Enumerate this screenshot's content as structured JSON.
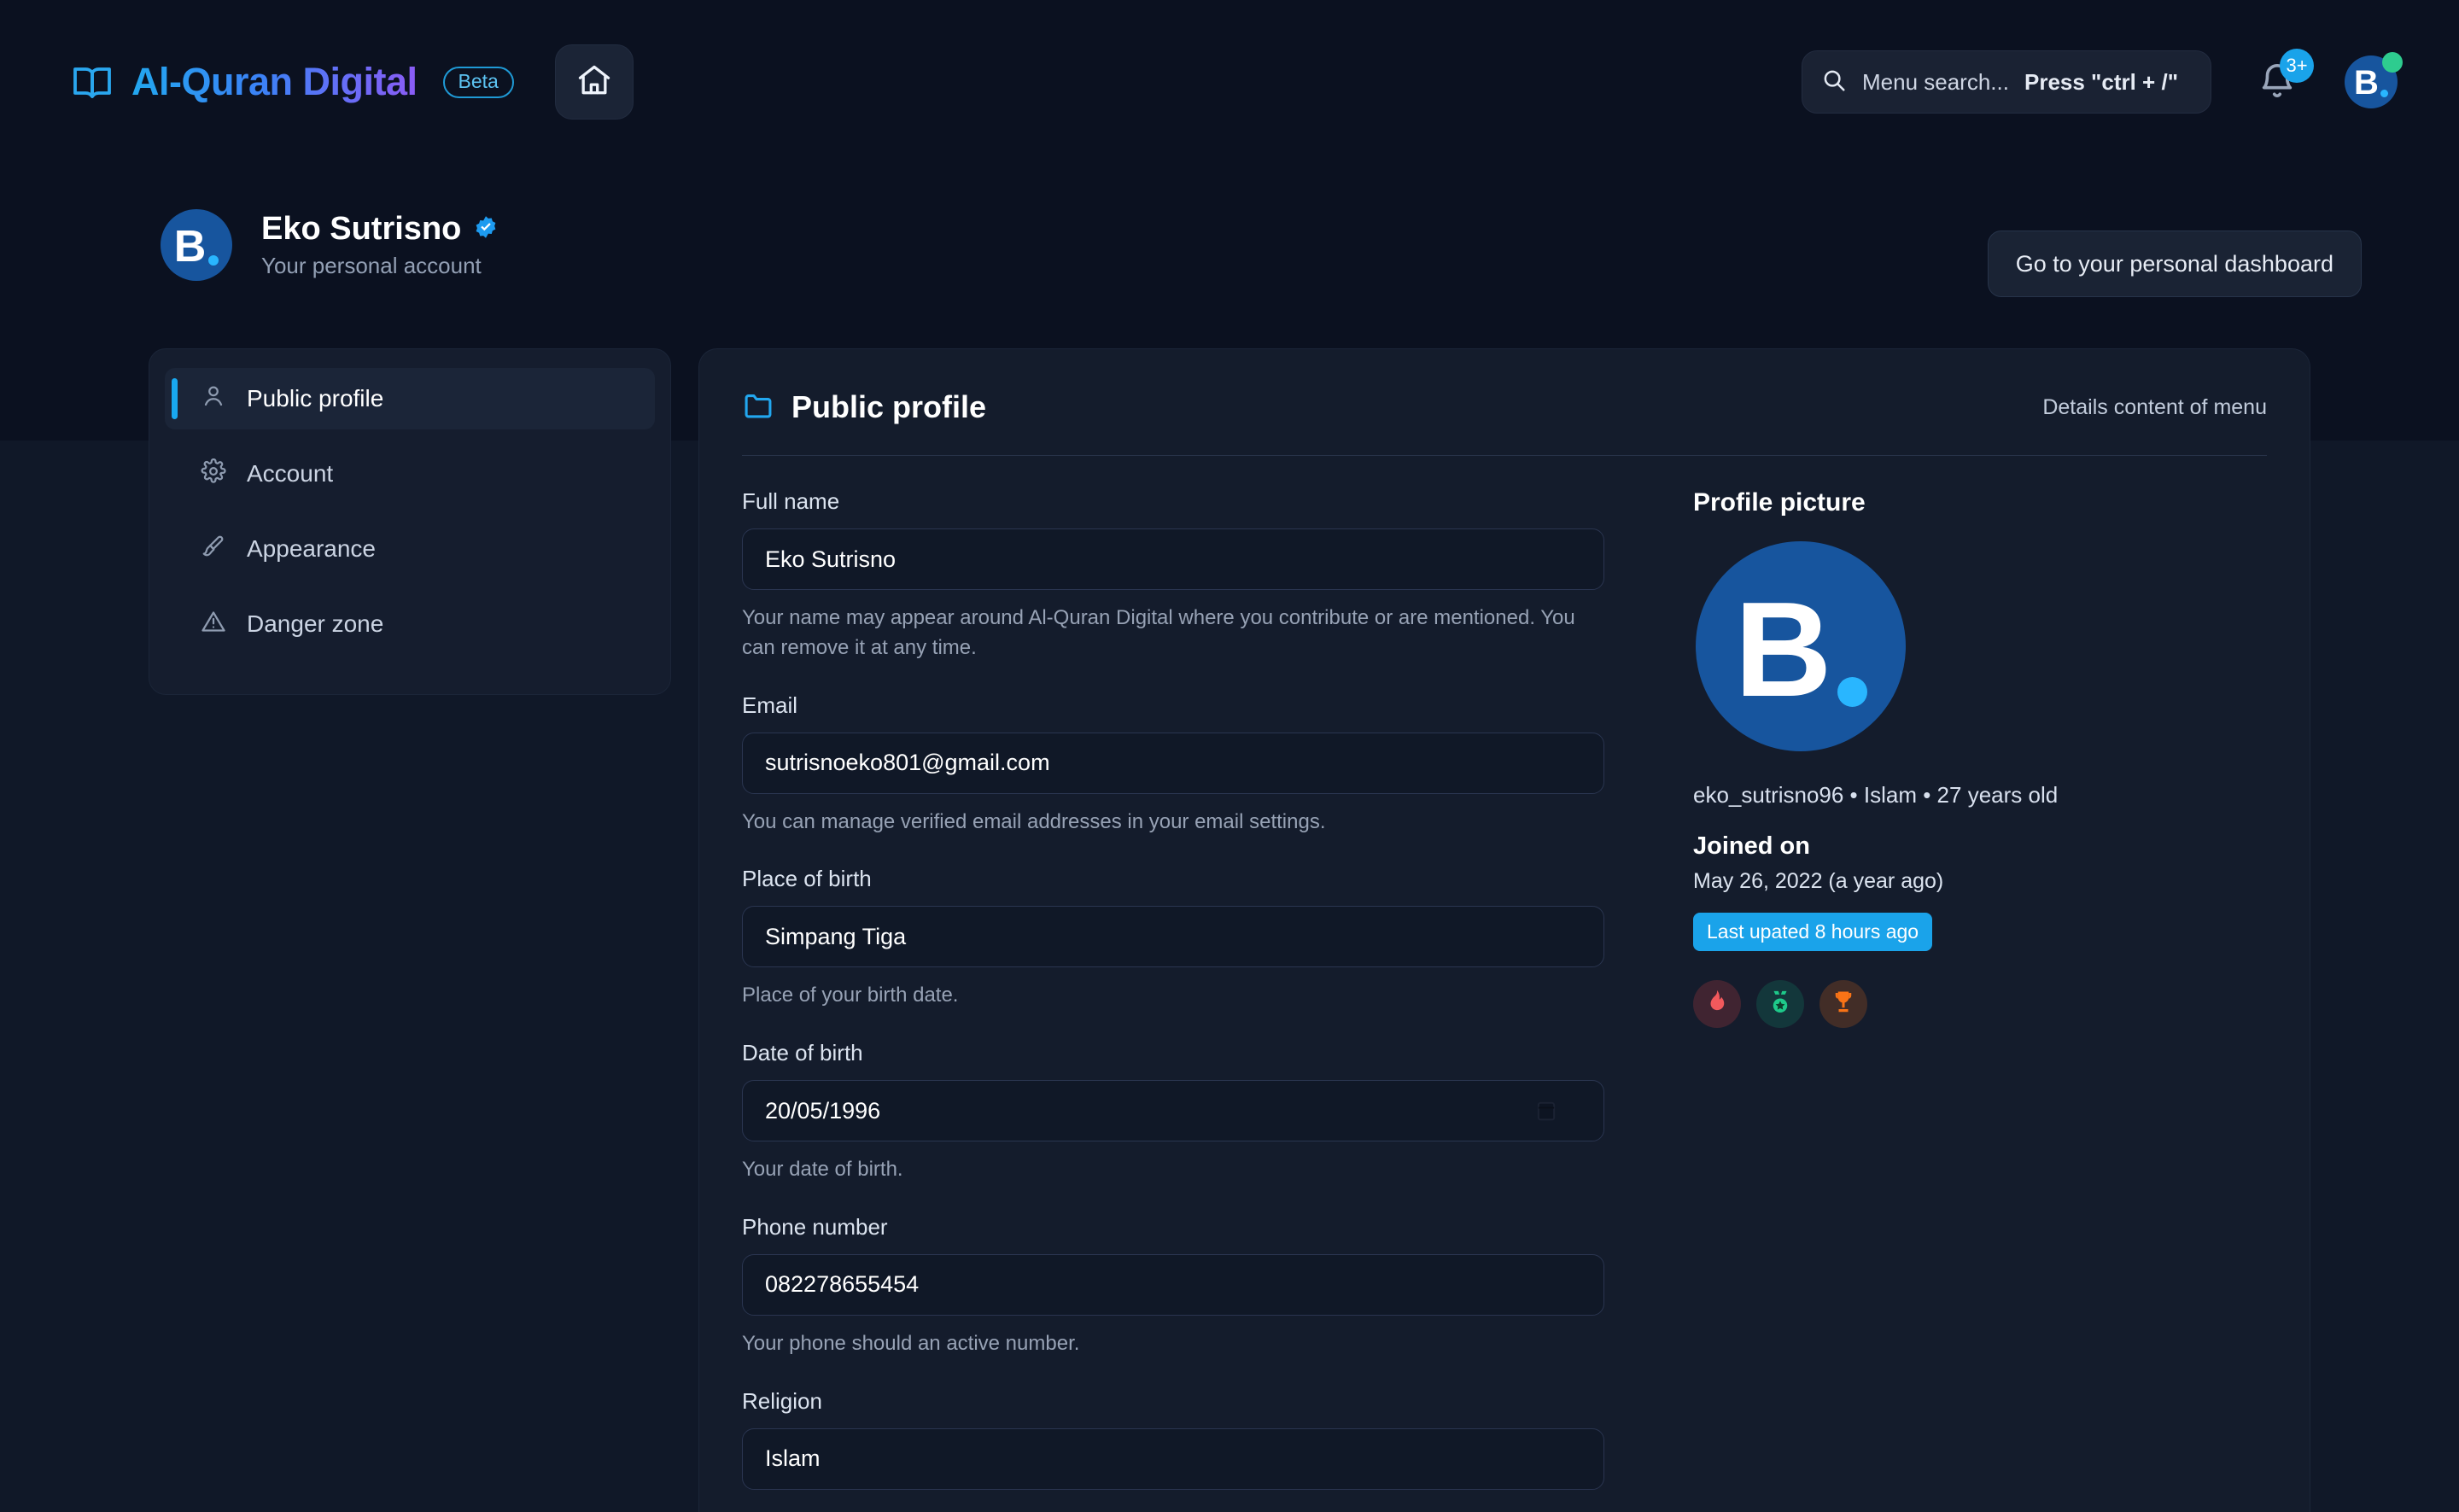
{
  "app": {
    "brand_name": "Al-Quran Digital",
    "beta_label": "Beta",
    "book_icon": "book-icon",
    "home_icon": "home-icon"
  },
  "topbar": {
    "search_placeholder": "Menu search...",
    "search_hint": "Press \"ctrl + /\"",
    "search_icon": "search-icon",
    "bell_icon": "bell-icon",
    "notification_count": "3+",
    "avatar_letter": "B",
    "status": "online"
  },
  "profile_header": {
    "avatar_letter": "B",
    "name": "Eko Sutrisno",
    "verified_icon": "verified-badge-icon",
    "subtitle": "Your personal account",
    "dashboard_button": "Go to your personal dashboard"
  },
  "sidebar": {
    "items": [
      {
        "label": "Public profile",
        "icon": "user-icon",
        "active": true
      },
      {
        "label": "Account",
        "icon": "gear-icon",
        "active": false
      },
      {
        "label": "Appearance",
        "icon": "brush-icon",
        "active": false
      },
      {
        "label": "Danger zone",
        "icon": "warning-triangle-icon",
        "active": false
      }
    ]
  },
  "main": {
    "title": "Public profile",
    "title_icon": "folder-icon",
    "details_label": "Details content of menu",
    "fields": [
      {
        "label": "Full name",
        "value": "Eko Sutrisno",
        "hint": "Your name may appear around Al-Quran Digital where you contribute or are mentioned. You can remove it at any time."
      },
      {
        "label": "Email",
        "value": "sutrisnoeko801@gmail.com",
        "hint": "You can manage verified email addresses in your email settings."
      },
      {
        "label": "Place of birth",
        "value": "Simpang Tiga",
        "hint": "Place of your birth date."
      },
      {
        "label": "Date of birth",
        "value": "20/05/1996",
        "hint": "Your date of birth.",
        "icon": "calendar-icon"
      },
      {
        "label": "Phone number",
        "value": "082278655454",
        "hint": "Your phone should an active number."
      },
      {
        "label": "Religion",
        "value": "Islam",
        "hint": ""
      }
    ]
  },
  "side_panel": {
    "picture_title": "Profile picture",
    "avatar_letter": "B",
    "meta": "eko_sutrisno96 • Islam • 27 years old",
    "joined_title": "Joined on",
    "joined_date": "May 26, 2022 (a year ago)",
    "updated_badge": "Last upated 8 hours ago",
    "badges": [
      {
        "name": "flame-badge",
        "icon": "flame-icon"
      },
      {
        "name": "medal-badge",
        "icon": "medal-icon"
      },
      {
        "name": "trophy-badge",
        "icon": "trophy-icon"
      }
    ]
  },
  "colors": {
    "accent": "#19a8ef",
    "brand_start": "#22a7ef",
    "brand_end": "#8b5cf6",
    "avatar_bg": "#17559e",
    "badge_blue": "#1aa3ea",
    "status_green": "#2ecc8f"
  }
}
